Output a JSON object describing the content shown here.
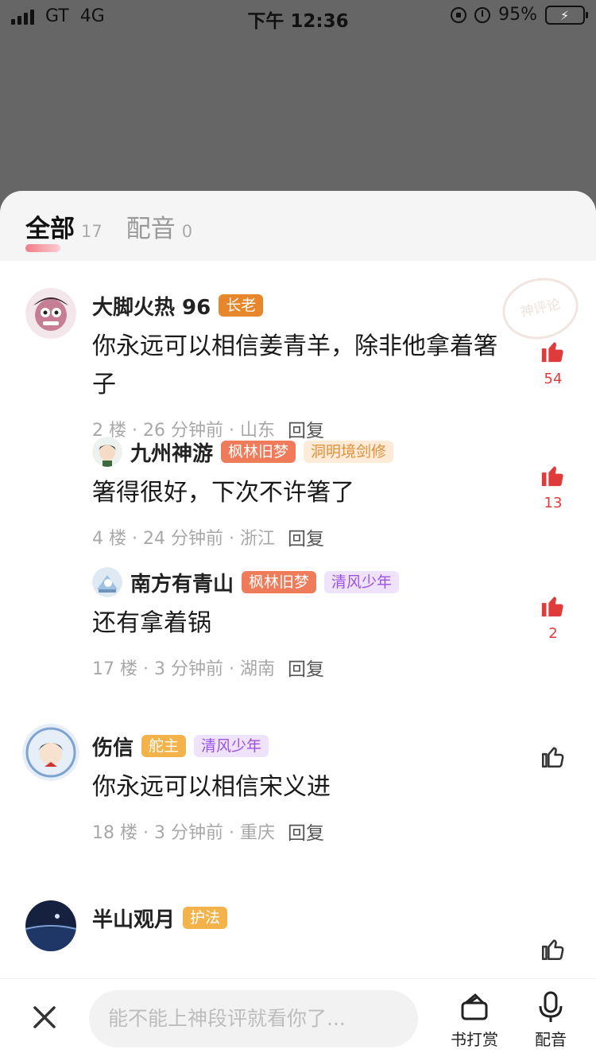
{
  "status_bar": {
    "carrier": "GT",
    "network": "4G",
    "time": "下午 12:36",
    "battery": "95%"
  },
  "tabs": [
    {
      "label": "全部",
      "count": "17"
    },
    {
      "label": "配音",
      "count": "0"
    }
  ],
  "watermark": "神评论",
  "comments": [
    {
      "name": "大脚火热 96",
      "badges": [
        "长老"
      ],
      "text": "你永远可以相信姜青羊，除非他拿着箸子",
      "floor": "2 楼",
      "time": "26 分钟前",
      "region": "山东",
      "reply": "回复",
      "likes": "54"
    },
    {
      "name": "九州神游",
      "badges": [
        "枫林旧梦",
        "洞明境剑修"
      ],
      "text": "箸得很好，下次不许箸了",
      "floor": "4 楼",
      "time": "24 分钟前",
      "region": "浙江",
      "reply": "回复",
      "likes": "13"
    },
    {
      "name": "南方有青山",
      "badges": [
        "枫林旧梦",
        "清风少年"
      ],
      "text": "还有拿着锅",
      "floor": "17 楼",
      "time": "3 分钟前",
      "region": "湖南",
      "reply": "回复",
      "likes": "2"
    },
    {
      "name": "伤信",
      "badges": [
        "舵主",
        "清风少年"
      ],
      "text": "你永远可以相信宋义进",
      "floor": "18 楼",
      "time": "3 分钟前",
      "region": "重庆",
      "reply": "回复",
      "likes": ""
    },
    {
      "name": "半山观月",
      "badges": [
        "护法"
      ]
    }
  ],
  "bottom_bar": {
    "placeholder": "能不能上神段评就看你了...",
    "tip_label": "书打赏",
    "dub_label": "配音"
  },
  "colors": {
    "like_red": "#e03b3b",
    "accent_pink": "#f25b6c"
  }
}
